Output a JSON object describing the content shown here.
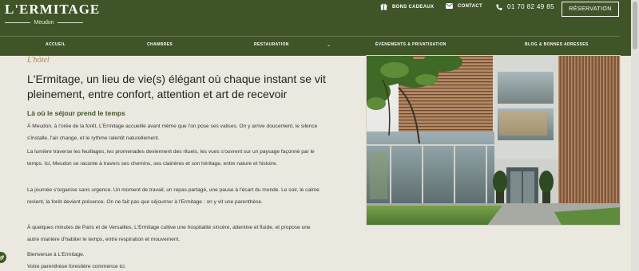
{
  "brand": {
    "name": "L'ERMITAGE",
    "location": "Meudon"
  },
  "utility": {
    "gift_label": "BONS CADEAUX",
    "gift_icon": "gift-icon",
    "contact_label": "CONTACT",
    "contact_icon": "envelope-icon",
    "phone": "01 70 82 49 85",
    "phone_icon": "phone-icon",
    "reservation_label": "RÉSERVATION"
  },
  "nav": {
    "items": [
      "ACCUEIL",
      "CHAMBRES",
      "RESTAURATION",
      "ÉVÉNEMENTS & PRIVATISATION",
      "BLOG & BONNES ADRESSES"
    ],
    "dropdown_icon": "chevron-down-icon"
  },
  "content": {
    "kicker": "L'hôtel",
    "headline": "L'Ermitage, un lieu de vie(s) élégant où chaque instant se vit pleinement, entre confort, attention et art de recevoir",
    "subheading": "Là où le séjour prend le temps",
    "paragraphs": [
      "À Meudon, à l'orée de la forêt, L'Ermitage accueille avant même que l'on pose ses valises. On y arrive doucement, le silence s'installe, l'air change, et le rythme ralentit naturellement.",
      "La lumière traverse les feuillages, les promenades deviennent des rituels, les vues s'ouvrent sur un paysage façonné par le temps. Ici, Meudon se raconte à travers ses chemins, ses clairières et son héritage, entre nature et histoire.",
      "La journée s'organise sans urgence. Un moment de travail, un repas partagé, une pause à l'écart du monde. Le soir, le calme revient, la forêt devient présence. On ne fait pas que séjourner à l'Ermitage : on y vit une parenthèse.",
      "À quelques minutes de Paris et de Versailles, L'Ermitage cultive une hospitalité sincère, attentive et fluide, et propose une autre manière d'habiter le temps, entre respiration et mouvement."
    ],
    "closing_line_1": "Bienvenue à L'Ermitage.",
    "closing_line_2": "Votre parenthèse forestière commence ici."
  },
  "colors": {
    "header_green": "#3f5427",
    "page_background": "#ebe8e0",
    "kicker_gold": "#a8895a",
    "subheading_green": "#405427"
  }
}
